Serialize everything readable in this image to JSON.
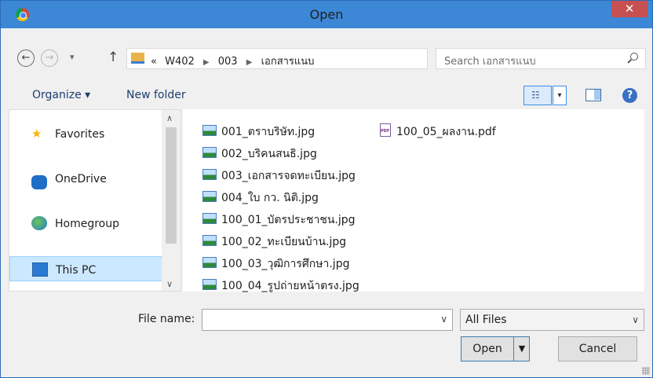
{
  "window": {
    "title": "Open",
    "close_label": "✕"
  },
  "address": {
    "breadcrumb": [
      "«",
      "W402",
      "003",
      "เอกสารแนบ"
    ],
    "search_placeholder": "Search เอกสารแนบ"
  },
  "toolbar": {
    "organize_label": "Organize ▾",
    "new_folder_label": "New folder",
    "help_label": "?"
  },
  "navpane": {
    "items": [
      {
        "label": "Favorites",
        "icon": "star-icon"
      },
      {
        "label": "OneDrive",
        "icon": "cloud-icon"
      },
      {
        "label": "Homegroup",
        "icon": "homegroup-icon"
      },
      {
        "label": "This PC",
        "icon": "computer-icon",
        "selected": true
      }
    ]
  },
  "files": [
    {
      "name": "001_ตราบริษัท.jpg",
      "type": "image"
    },
    {
      "name": "002_บริคนสนธิ.jpg",
      "type": "image"
    },
    {
      "name": "003_เอกสารจดทะเบียน.jpg",
      "type": "image"
    },
    {
      "name": "004_ใบ กว. นิติ.jpg",
      "type": "image"
    },
    {
      "name": "100_01_บัตรประชาชน.jpg",
      "type": "image"
    },
    {
      "name": "100_02_ทะเบียนบ้าน.jpg",
      "type": "image"
    },
    {
      "name": "100_03_วุฒิการศึกษา.jpg",
      "type": "image"
    },
    {
      "name": "100_04_รูปถ่ายหน้าตรง.jpg",
      "type": "image"
    },
    {
      "name": "100_05_ผลงาน.pdf",
      "type": "pdf"
    }
  ],
  "bottom": {
    "file_name_label": "File name:",
    "file_name_value": "",
    "filter_value": "All Files",
    "open_label": "Open",
    "cancel_label": "Cancel"
  }
}
